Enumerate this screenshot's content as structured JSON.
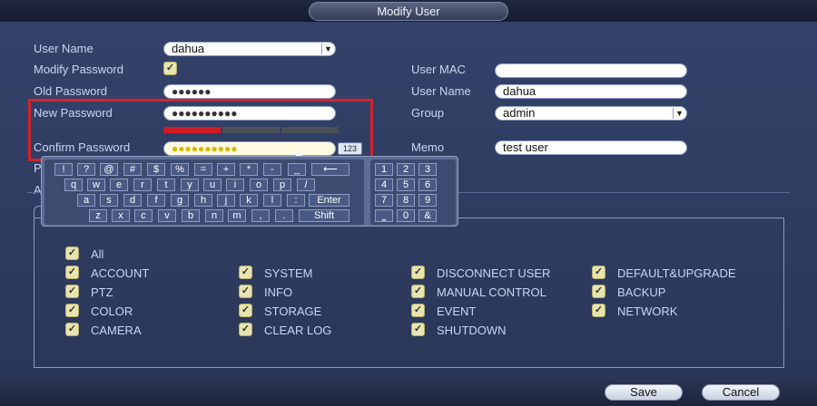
{
  "title": "Modify User",
  "left": {
    "user_name": {
      "label": "User Name",
      "value": "dahua"
    },
    "modify_password": {
      "label": "Modify Password",
      "checked": true
    },
    "old_password": {
      "label": "Old Password",
      "value": "●●●●●●"
    },
    "new_password": {
      "label": "New Password",
      "value": "●●●●●●●●●●"
    },
    "confirm_password": {
      "label": "Confirm Password",
      "value": "●●●●●●●●●●"
    },
    "toggle_123": "123",
    "hidden_p": "P",
    "hidden_a": "A"
  },
  "right": {
    "user_mac": {
      "label": "User MAC",
      "value": ""
    },
    "user_name": {
      "label": "User Name",
      "value": "dahua"
    },
    "group": {
      "label": "Group",
      "value": "admin"
    },
    "memo": {
      "label": "Memo",
      "value": "test user"
    }
  },
  "strength": {
    "level": 1,
    "segments": 3,
    "colors": {
      "active": "#d11b24",
      "inactive": "#4b4f5a"
    }
  },
  "keyboard": {
    "row1": [
      "!",
      "?",
      "@",
      "#",
      "$",
      "%",
      "=",
      "+",
      "*",
      "-",
      "_",
      "⟵"
    ],
    "row2": [
      "q",
      "w",
      "e",
      "r",
      "t",
      "y",
      "u",
      "i",
      "o",
      "p",
      "/"
    ],
    "row3": [
      "a",
      "s",
      "d",
      "f",
      "g",
      "h",
      "j",
      "k",
      "l",
      ":",
      "Enter"
    ],
    "row4": [
      "z",
      "x",
      "c",
      "v",
      "b",
      "n",
      "m",
      ",",
      ".",
      "Shift"
    ],
    "numpad": [
      "1",
      "2",
      "3",
      "4",
      "5",
      "6",
      "7",
      "8",
      "9",
      "⎵",
      "0",
      "&"
    ]
  },
  "permissions": {
    "all": "All",
    "col1": [
      "ACCOUNT",
      "PTZ",
      "COLOR",
      "CAMERA"
    ],
    "col2": [
      "SYSTEM",
      "INFO",
      "STORAGE",
      "CLEAR LOG"
    ],
    "col3": [
      "DISCONNECT USER",
      "MANUAL CONTROL",
      "EVENT",
      "SHUTDOWN"
    ],
    "col4": [
      "DEFAULT&UPGRADE",
      "BACKUP",
      "NETWORK"
    ]
  },
  "buttons": {
    "save": "Save",
    "cancel": "Cancel"
  },
  "colors": {
    "accent_red": "#d1232e",
    "background": "#2e3b60"
  }
}
